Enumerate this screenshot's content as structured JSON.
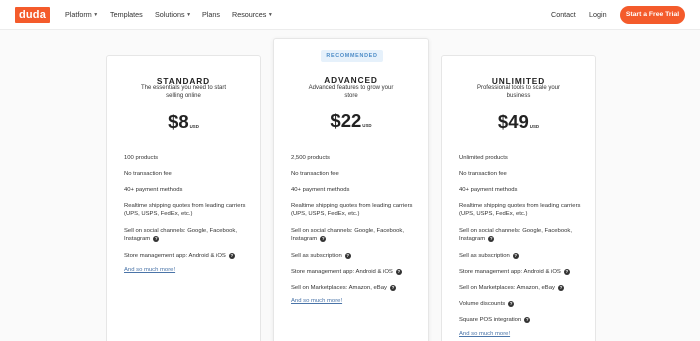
{
  "nav": {
    "logo": "duda",
    "items": [
      {
        "label": "Platform",
        "dropdown": true
      },
      {
        "label": "Templates",
        "dropdown": false
      },
      {
        "label": "Solutions",
        "dropdown": true
      },
      {
        "label": "Plans",
        "dropdown": false
      },
      {
        "label": "Resources",
        "dropdown": true
      }
    ],
    "contact": "Contact",
    "login": "Login",
    "cta": "Start a Free Trial"
  },
  "plans": [
    {
      "name": "STANDARD",
      "description": "The essentials you need to start selling online",
      "price": "$8",
      "currency": "USD",
      "features": [
        {
          "text": "100 products",
          "help": false
        },
        {
          "text": "No transaction fee",
          "help": false
        },
        {
          "text": "40+ payment methods",
          "help": false
        },
        {
          "text": "Realtime shipping quotes from leading carriers (UPS, USPS, FedEx, etc.)",
          "help": false
        },
        {
          "text": "Sell on social channels: Google, Facebook, Instagram",
          "help": true
        },
        {
          "text": "Store management app: Android & iOS",
          "help": true
        }
      ],
      "more": "And so much more!"
    },
    {
      "name": "ADVANCED",
      "badge": "RECOMMENDED",
      "description": "Advanced features to grow your store",
      "price": "$22",
      "currency": "USD",
      "features": [
        {
          "text": "2,500 products",
          "help": false
        },
        {
          "text": "No transaction fee",
          "help": false
        },
        {
          "text": "40+ payment methods",
          "help": false
        },
        {
          "text": "Realtime shipping quotes from leading carriers (UPS, USPS, FedEx, etc.)",
          "help": false
        },
        {
          "text": "Sell on social channels: Google, Facebook, Instagram",
          "help": true
        },
        {
          "text": "Sell as subscription",
          "help": true
        },
        {
          "text": "Store management app: Android & iOS",
          "help": true
        },
        {
          "text": "Sell on Marketplaces: Amazon, eBay",
          "help": true
        }
      ],
      "more": "And so much more!"
    },
    {
      "name": "UNLIMITED",
      "description": "Professional tools to scale your business",
      "price": "$49",
      "currency": "USD",
      "features": [
        {
          "text": "Unlimited products",
          "help": false
        },
        {
          "text": "No transaction fee",
          "help": false
        },
        {
          "text": "40+ payment methods",
          "help": false
        },
        {
          "text": "Realtime shipping quotes from leading carriers (UPS, USPS, FedEx, etc.)",
          "help": false
        },
        {
          "text": "Sell on social channels: Google, Facebook, Instagram",
          "help": true
        },
        {
          "text": "Sell as subscription",
          "help": true
        },
        {
          "text": "Store management app: Android & iOS",
          "help": true
        },
        {
          "text": "Sell on Marketplaces: Amazon, eBay",
          "help": true
        },
        {
          "text": "Volume discounts",
          "help": true
        },
        {
          "text": "Square POS integration",
          "help": true
        }
      ],
      "more": "And so much more!"
    }
  ],
  "colors": {
    "brand": "#f45b2b",
    "link": "#4a74a8",
    "badge_bg": "#e6f1fb",
    "badge_text": "#4d8cc7"
  },
  "icons": {
    "help": "question-circle-icon",
    "dropdown": "chevron-down-icon"
  }
}
